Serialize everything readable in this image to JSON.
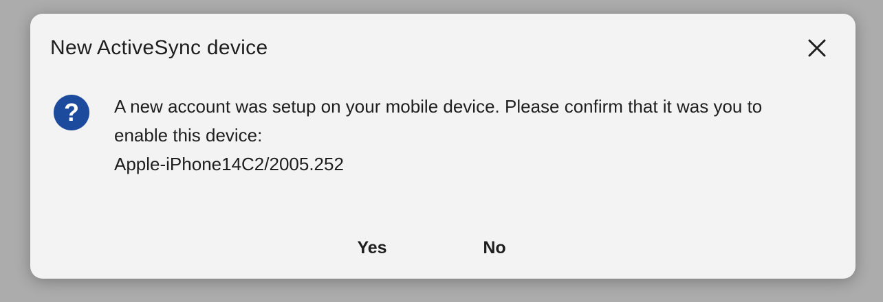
{
  "dialog": {
    "title": "New ActiveSync device",
    "close_icon": "close-icon",
    "icon": "question-icon",
    "icon_color": "#1c4a9c",
    "message": {
      "line1": "A new account was setup on your mobile device. Please confirm that it was you to",
      "line2": "enable this device:",
      "device": "Apple-iPhone14C2/2005.252"
    },
    "buttons": {
      "yes": "Yes",
      "no": "No"
    }
  }
}
